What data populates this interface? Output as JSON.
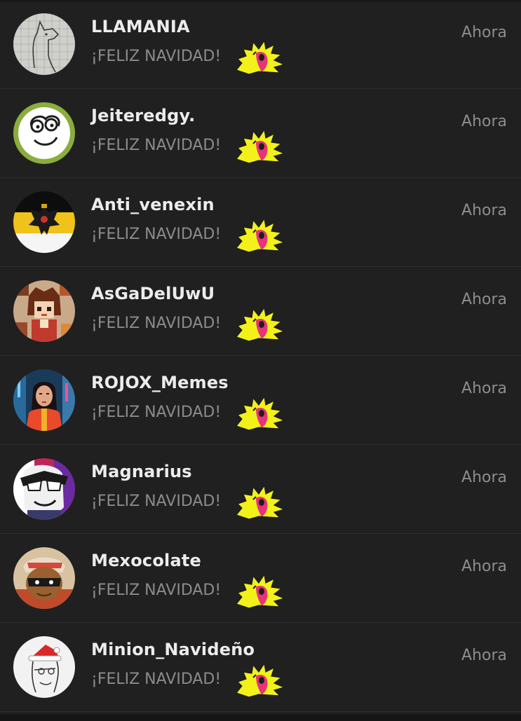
{
  "conversations": [
    {
      "username": "LLAMANIA",
      "message": "¡FELIZ NAVIDAD!",
      "time": "Ahora",
      "avatar": "llama-sketch-avatar"
    },
    {
      "username": "Jeiteredgy.",
      "message": "¡FELIZ NAVIDAD!",
      "time": "Ahora",
      "avatar": "smiling-face-avatar"
    },
    {
      "username": "Anti_venexin",
      "message": "¡FELIZ NAVIDAD!",
      "time": "Ahora",
      "avatar": "imperial-eagle-flag-avatar"
    },
    {
      "username": "AsGaDelUwU",
      "message": "¡FELIZ NAVIDAD!",
      "time": "Ahora",
      "avatar": "pixel-anime-girl-avatar"
    },
    {
      "username": "ROJOX_Memes",
      "message": "¡FELIZ NAVIDAD!",
      "time": "Ahora",
      "avatar": "neon-city-girl-avatar"
    },
    {
      "username": "Magnarius",
      "message": "¡FELIZ NAVIDAD!",
      "time": "Ahora",
      "avatar": "cartoon-hero-avatar"
    },
    {
      "username": "Mexocolate",
      "message": "¡FELIZ NAVIDAD!",
      "time": "Ahora",
      "avatar": "masked-character-avatar"
    },
    {
      "username": "Minion_Navideño",
      "message": "¡FELIZ NAVIDAD!",
      "time": "Ahora",
      "avatar": "santa-hat-sketch-avatar"
    }
  ],
  "colors": {
    "background": "#202020",
    "username": "#ececec",
    "message": "#8b8b8b",
    "time": "#8d8d8d",
    "emoji_yellow": "#f2f21a",
    "emoji_pink": "#e8327a"
  }
}
